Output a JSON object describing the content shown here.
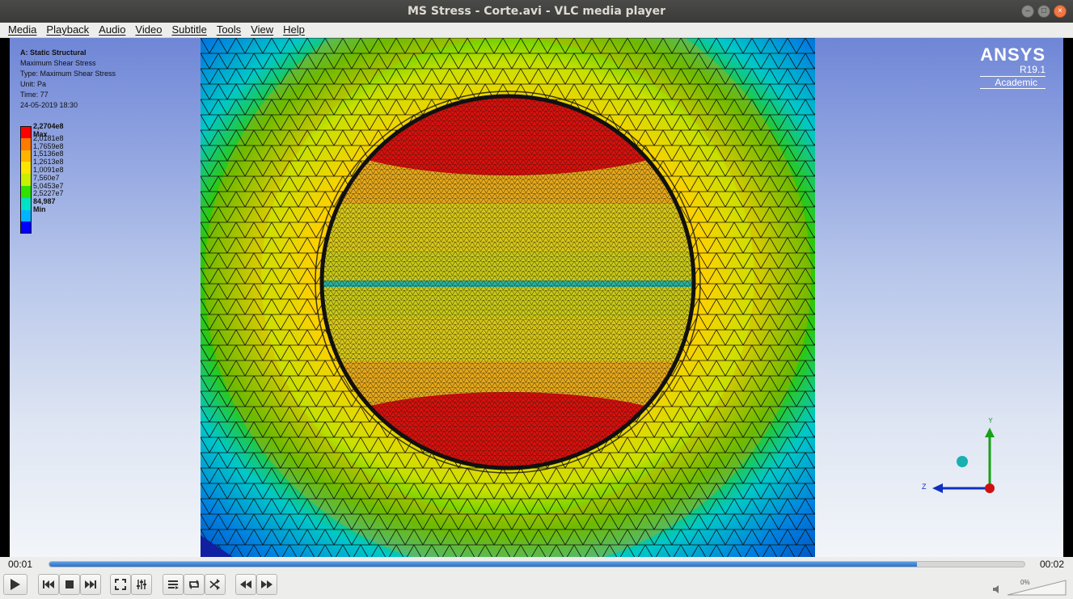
{
  "window": {
    "title": "MS Stress - Corte.avi - VLC media player"
  },
  "menu": {
    "items": [
      "Media",
      "Playback",
      "Audio",
      "Video",
      "Subtitle",
      "Tools",
      "View",
      "Help"
    ]
  },
  "overlay": {
    "info": [
      "A: Static Structural",
      "Maximum Shear Stress",
      "Type: Maximum Shear Stress",
      "Unit: Pa",
      "Time: 77",
      "24-05-2019 18:30"
    ],
    "legend": {
      "labels": [
        "2,2704e8 Max",
        "2,0181e8",
        "1,7659e8",
        "1,5136e8",
        "1,2613e8",
        "1,0091e8",
        "7,560e7",
        "5,0453e7",
        "2,5227e7",
        "84,987 Min"
      ],
      "colors": [
        "#ff0000",
        "#ff7a00",
        "#ffb400",
        "#ffe600",
        "#c8f000",
        "#31e100",
        "#00e1c8",
        "#00b4ff",
        "#0064ff",
        "#0000ff"
      ]
    },
    "brand": {
      "name": "ANSYS",
      "version": "R19.1",
      "edition": "Academic"
    },
    "axes": {
      "y_label": "Y",
      "z_label": "Z"
    }
  },
  "playback": {
    "current_time": "00:01",
    "total_time": "00:02",
    "progress": 0.89,
    "volume": "0%"
  },
  "colors": {
    "progress": "#2f6fc4",
    "titlebar": "#3c3b37",
    "close": "#f07746"
  }
}
